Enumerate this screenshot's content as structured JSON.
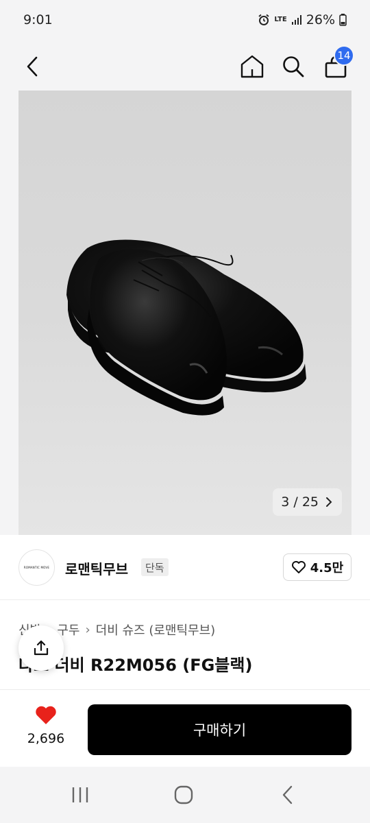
{
  "status_bar": {
    "time": "9:01",
    "network": "LTE",
    "battery": "26%",
    "icons": [
      "alarm-icon",
      "lte-icon",
      "signal-icon",
      "battery-icon"
    ]
  },
  "header": {
    "icons": [
      "back-icon",
      "home-icon",
      "search-icon",
      "cart-icon"
    ],
    "cart_count": "14"
  },
  "gallery": {
    "current": "3",
    "total": "25",
    "counter_text": "3 / 25"
  },
  "brand": {
    "logo_text": "ROMANTIC MOVE",
    "name": "로맨틱무브",
    "tag": "단독",
    "likes": "4.5만"
  },
  "breadcrumb": [
    "신발",
    "구두",
    "더비 슈즈 (로맨틱무브)"
  ],
  "product": {
    "title": "다쏘 더비 R22M056 (FG블랙)"
  },
  "action_bar": {
    "wish_count": "2,696",
    "buy_label": "구매하기"
  },
  "colors": {
    "accent": "#2f6bef",
    "heart": "#e8221b",
    "buy_button": "#000000"
  },
  "nav_bar": {
    "icons": [
      "recent-apps-icon",
      "home-circle-icon",
      "back-nav-icon"
    ]
  }
}
